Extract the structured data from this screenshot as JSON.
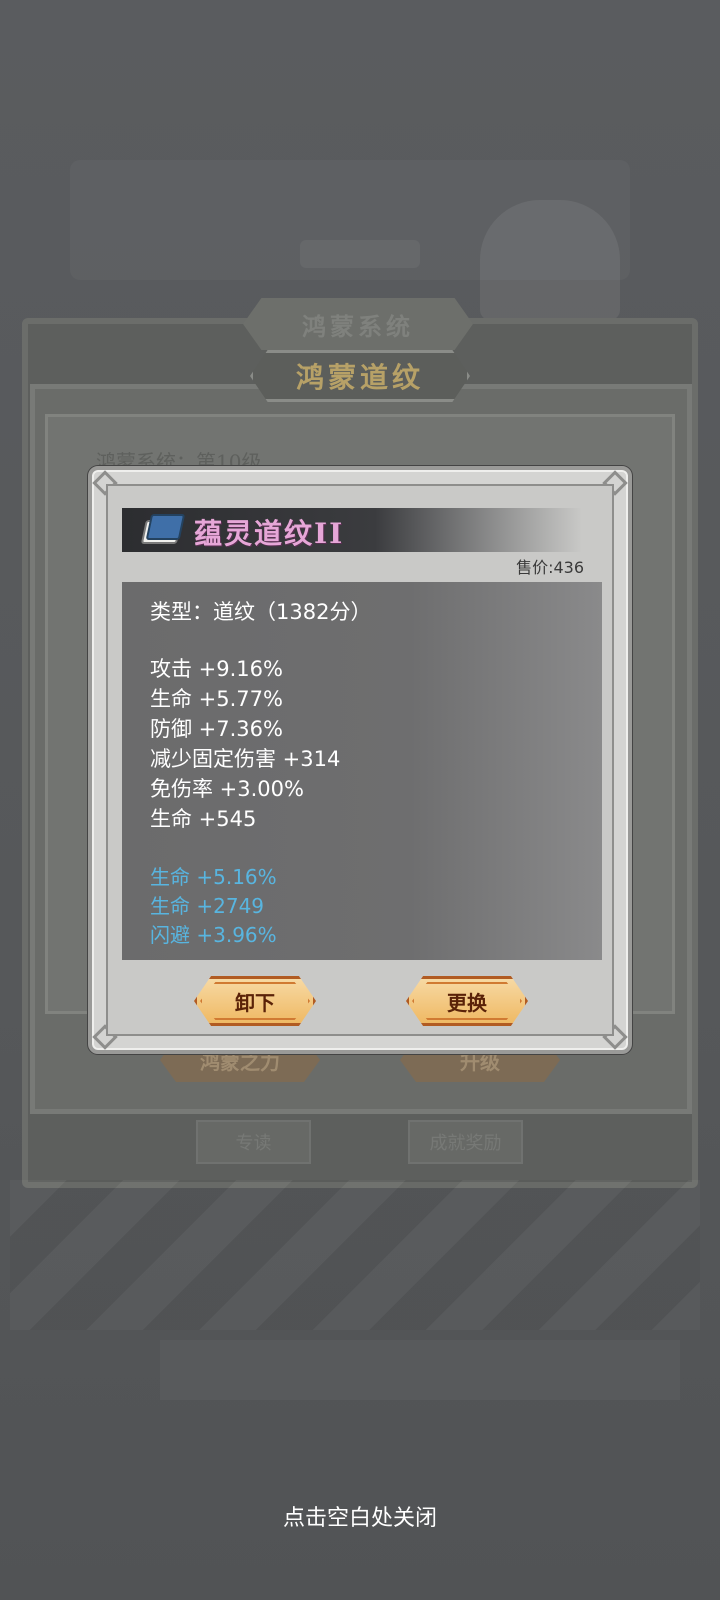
{
  "background": {
    "system_plaque": "鸿蒙系统",
    "daowen_plaque": "鸿蒙道纹",
    "level_text": "鸿蒙系统：第10级",
    "power_button": "鸿蒙之力",
    "upgrade_button": "升级",
    "study_tab": "专读",
    "achievement_tab": "成就奖励"
  },
  "dialog": {
    "item_name": "蕴灵道纹II",
    "sell_price": "售价:436",
    "type_line": "类型：道纹（1382分）",
    "stats": [
      "攻击 +9.16%",
      "生命 +5.77%",
      "防御 +7.36%",
      "减少固定伤害 +314",
      "免伤率 +3.00%",
      "生命 +545"
    ],
    "extra_stats": [
      "生命 +5.16%",
      "生命 +2749",
      "闪避 +3.96%"
    ],
    "unequip_label": "卸下",
    "replace_label": "更换"
  },
  "close_hint": "点击空白处关闭",
  "colors": {
    "item_name": "#e6a6d7",
    "extra_stat": "#58b5e0",
    "button_border": "#b15b22"
  }
}
